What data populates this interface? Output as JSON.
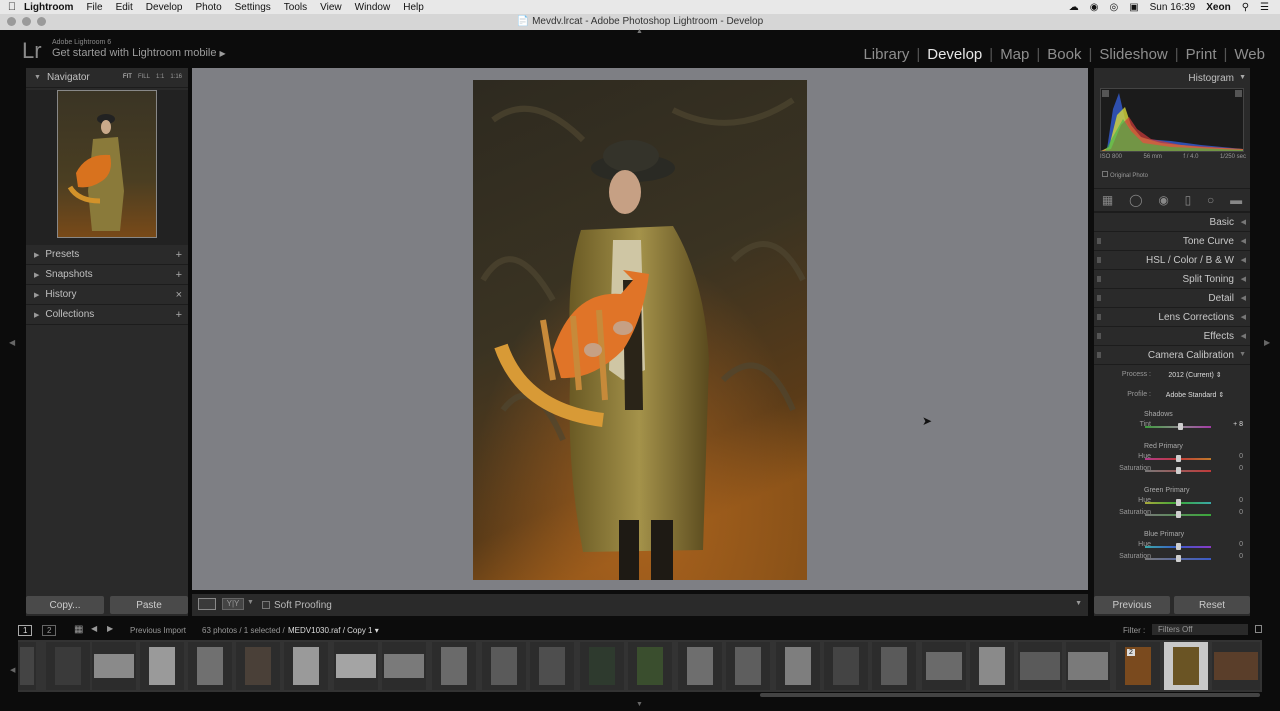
{
  "menubar": {
    "apple": "",
    "items": [
      "Lightroom",
      "File",
      "Edit",
      "Develop",
      "Photo",
      "Settings",
      "Tools",
      "View",
      "Window",
      "Help"
    ],
    "clock": "Sun 16:39",
    "user": "Xeon"
  },
  "window": {
    "title": "Mevdv.lrcat - Adobe Photoshop Lightroom - Develop"
  },
  "identity": {
    "logo": "Lr",
    "version": "Adobe Lightroom 6",
    "mobile": "Get started with Lightroom mobile"
  },
  "modules": [
    {
      "label": "Library",
      "active": false
    },
    {
      "label": "Develop",
      "active": true
    },
    {
      "label": "Map",
      "active": false
    },
    {
      "label": "Book",
      "active": false
    },
    {
      "label": "Slideshow",
      "active": false
    },
    {
      "label": "Print",
      "active": false
    },
    {
      "label": "Web",
      "active": false
    }
  ],
  "left": {
    "navigator": {
      "title": "Navigator",
      "sizes": [
        "FIT",
        "FILL",
        "1:1",
        "1:16"
      ]
    },
    "panels": [
      {
        "label": "Presets",
        "action": "+"
      },
      {
        "label": "Snapshots",
        "action": "+"
      },
      {
        "label": "History",
        "action": "×"
      },
      {
        "label": "Collections",
        "action": "+"
      }
    ],
    "copy_label": "Copy...",
    "paste_label": "Paste"
  },
  "toolbar": {
    "soft_proofing": "Soft Proofing"
  },
  "right": {
    "histogram_title": "Histogram",
    "histinfo": {
      "iso": "ISO 800",
      "focal": "56 mm",
      "aperture": "f / 4.0",
      "shutter": "1/250 sec"
    },
    "original_photo": "Original Photo",
    "panels": [
      "Basic",
      "Tone Curve",
      "HSL / Color / B & W",
      "Split Toning",
      "Detail",
      "Lens Corrections",
      "Effects",
      "Camera Calibration"
    ],
    "calibration": {
      "process_label": "Process :",
      "process_value": "2012 (Current)",
      "profile_label": "Profile :",
      "profile_value": "Adobe Standard",
      "shadows": {
        "title": "Shadows",
        "tint_label": "Tint",
        "tint_value": "+ 8"
      },
      "red": {
        "title": "Red Primary",
        "hue_label": "Hue",
        "hue_value": "0",
        "sat_label": "Saturation",
        "sat_value": "0"
      },
      "green": {
        "title": "Green Primary",
        "hue_label": "Hue",
        "hue_value": "0",
        "sat_label": "Saturation",
        "sat_value": "0"
      },
      "blue": {
        "title": "Blue Primary",
        "hue_label": "Hue",
        "hue_value": "0",
        "sat_label": "Saturation",
        "sat_value": "0"
      }
    },
    "previous_label": "Previous",
    "reset_label": "Reset"
  },
  "filmstrip": {
    "view1": "1",
    "view2": "2",
    "source": "Previous Import",
    "count": "63 photos / 1 selected /",
    "file": "MEDV1030.raf / Copy 1",
    "filter_label": "Filter :",
    "filter_value": "Filters Off",
    "badge": "2"
  },
  "colors": {
    "accent_text": "#e6e6e6",
    "panel_bg": "#2a2a2a",
    "canvas_bg": "#7e7f84"
  }
}
